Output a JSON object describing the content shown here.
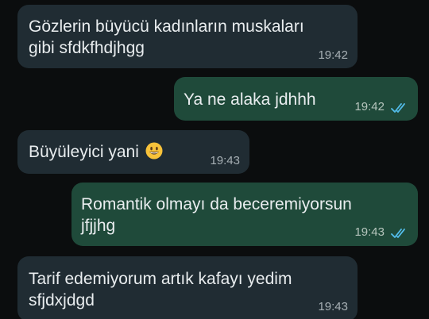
{
  "messages": [
    {
      "direction": "incoming",
      "text": "Gözlerin büyücü kadınların muskaları\ngibi sfdkfhdjhgg",
      "time": "19:42"
    },
    {
      "direction": "outgoing",
      "text": "Ya ne alaka jdhhh",
      "time": "19:42",
      "status": "read"
    },
    {
      "direction": "incoming",
      "text": "Büyüleyici yani",
      "emoji": "grinning-face",
      "time": "19:43"
    },
    {
      "direction": "outgoing",
      "text": "Romantik olmayı da beceremiyorsun\njfjjhg",
      "time": "19:43",
      "status": "read"
    },
    {
      "direction": "incoming",
      "text": "Tarif edemiyorum artık kafayı yedim\nsfjdxjdgd",
      "time": "19:43"
    }
  ],
  "colors": {
    "background": "#0b0d0e",
    "incoming_bubble": "#202c33",
    "outgoing_bubble": "#1f4a3a",
    "read_tick": "#53bdeb",
    "text": "#e9edef"
  }
}
